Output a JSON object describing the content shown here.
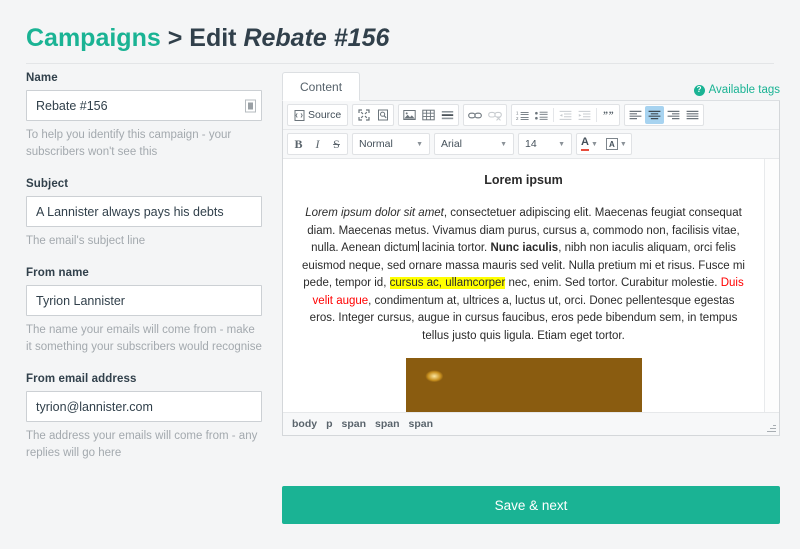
{
  "header": {
    "breadcrumb_root": "Campaigns",
    "breadcrumb_separator": ">",
    "breadcrumb_action": "Edit",
    "breadcrumb_target": "Rebate #156"
  },
  "form": {
    "fields": [
      {
        "label": "Name",
        "value": "Rebate #156",
        "placeholder": "Name",
        "help": "To help you identify this campaign - your subscribers won't see this",
        "has_autofill_icon": true
      },
      {
        "label": "Subject",
        "value": "A Lannister always pays his debts",
        "placeholder": "Subject",
        "help": "The email's subject line",
        "has_autofill_icon": false
      },
      {
        "label": "From name",
        "value": "Tyrion Lannister",
        "placeholder": "From name",
        "help": "The name your emails will come from - make it something your subscribers would recognise",
        "has_autofill_icon": false
      },
      {
        "label": "From email address",
        "value": "tyrion@lannister.com",
        "placeholder": "From email address",
        "help": "The address your emails will come from - any replies will go here",
        "has_autofill_icon": false
      }
    ]
  },
  "tabs": {
    "items": [
      {
        "label": "Content",
        "active": true
      }
    ],
    "available_tags_label": "Available tags",
    "available_tags_icon": "help-circle-icon"
  },
  "editor": {
    "toolbar_row1": {
      "source_label": "Source",
      "icons": [
        "source-icon",
        "maximize-icon",
        "preview-icon",
        "image-icon",
        "table-icon",
        "horizontal-rule-icon",
        "link-icon",
        "unlink-icon",
        "numbered-list-icon",
        "bulleted-list-icon",
        "outdent-icon",
        "indent-icon",
        "blockquote-icon",
        "align-left-icon",
        "align-center-icon",
        "align-right-icon",
        "align-justify-icon"
      ],
      "active_alignment": "align-center-icon",
      "disabled_icons": [
        "unlink-icon",
        "outdent-icon",
        "indent-icon"
      ]
    },
    "toolbar_row2": {
      "bold_label": "B",
      "italic_label": "I",
      "strike_label": "S",
      "paragraph_format": "Normal",
      "font_family": "Arial",
      "font_size": "14",
      "text_color_icon": "text-color-icon",
      "background_color_icon": "background-color-icon"
    },
    "document": {
      "title": "Lorem ipsum",
      "paragraph_parts": [
        {
          "text": "Lorem ipsum dolor sit amet",
          "style": "italic"
        },
        {
          "text": ", consectetuer adipiscing elit. Maecenas feugiat consequat diam. Maecenas metus. Vivamus diam purus, cursus a, commodo non, facilisis vitae, nulla. Aenean dictum",
          "style": "normal"
        },
        {
          "text": "",
          "style": "caret"
        },
        {
          "text": " lacinia tortor. ",
          "style": "normal"
        },
        {
          "text": "Nunc iaculis",
          "style": "bold"
        },
        {
          "text": ", nibh non iaculis aliquam, orci felis euismod neque, sed ornare massa mauris sed velit. Nulla pretium mi et risus. Fusce mi pede, tempor id, ",
          "style": "normal"
        },
        {
          "text": "cursus ac, ullamcorper",
          "style": "highlight"
        },
        {
          "text": " nec, enim. Sed tortor. Curabitur molestie. ",
          "style": "normal"
        },
        {
          "text": "Duis velit augue",
          "style": "red"
        },
        {
          "text": ", condimentum at, ultrices a, luctus ut, orci. Donec pellentesque egestas eros. Integer cursus, augue in cursus faucibus, eros pede bibendum sem, in tempus tellus justo quis ligula. Etiam eget tortor.",
          "style": "normal"
        }
      ],
      "image_alt": "gold-coins-image"
    },
    "element_path": [
      "body",
      "p",
      "span",
      "span",
      "span"
    ]
  },
  "footer": {
    "save_label": "Save & next"
  },
  "colors": {
    "brand_teal": "#1ab394",
    "heading_dark": "#31404b",
    "highlight_yellow": "#ffff00",
    "red_text": "#ff0000",
    "active_toolbar_blue": "#a7d3f0",
    "page_background": "#f4f5f6"
  }
}
